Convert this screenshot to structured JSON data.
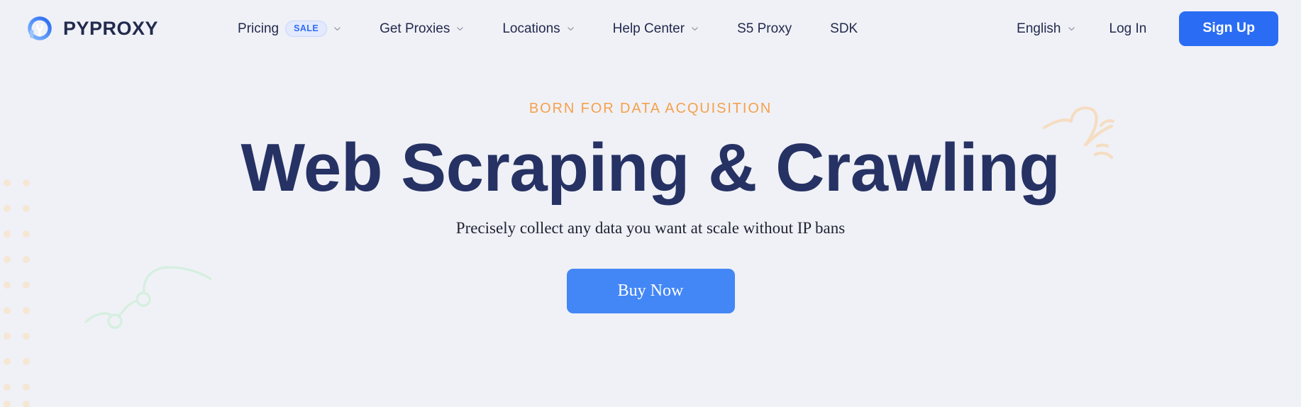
{
  "brand": {
    "name": "PYPROXY",
    "logo_icon": "pyproxy-circle-logo-icon"
  },
  "nav": {
    "items": [
      {
        "label": "Pricing",
        "badge": "SALE",
        "has_dropdown": true,
        "icon": "chevron-down-icon"
      },
      {
        "label": "Get Proxies",
        "badge": null,
        "has_dropdown": true,
        "icon": "chevron-down-icon"
      },
      {
        "label": "Locations",
        "badge": null,
        "has_dropdown": true,
        "icon": "chevron-down-icon"
      },
      {
        "label": "Help Center",
        "badge": null,
        "has_dropdown": true,
        "icon": "chevron-down-icon"
      },
      {
        "label": "S5 Proxy",
        "badge": null,
        "has_dropdown": false,
        "icon": null
      },
      {
        "label": "SDK",
        "badge": null,
        "has_dropdown": false,
        "icon": null
      }
    ],
    "language": {
      "label": "English",
      "icon": "chevron-down-icon"
    },
    "login_label": "Log In",
    "signup_label": "Sign Up"
  },
  "hero": {
    "eyebrow": "BORN FOR DATA ACQUISITION",
    "headline": "Web Scraping & Crawling",
    "subtitle": "Precisely collect any data you want at scale without IP bans",
    "cta_label": "Buy Now"
  },
  "decorations": {
    "dots": "dot-grid-decoration",
    "green_curve": "green-squiggle-decoration",
    "orange_curve": "orange-squiggle-decoration"
  },
  "colors": {
    "page_background": "#f0f1f6",
    "brand_navy": "#222a4e",
    "headline_navy": "#263264",
    "primary_blue": "#2a6df4",
    "cta_blue": "#4387f6",
    "accent_orange": "#f4a14c",
    "badge_blue_text": "#2f6bf3",
    "badge_blue_bg": "#e3eafd",
    "deco_dot": "#f7e8d8",
    "deco_green": "#d9f0e2"
  }
}
